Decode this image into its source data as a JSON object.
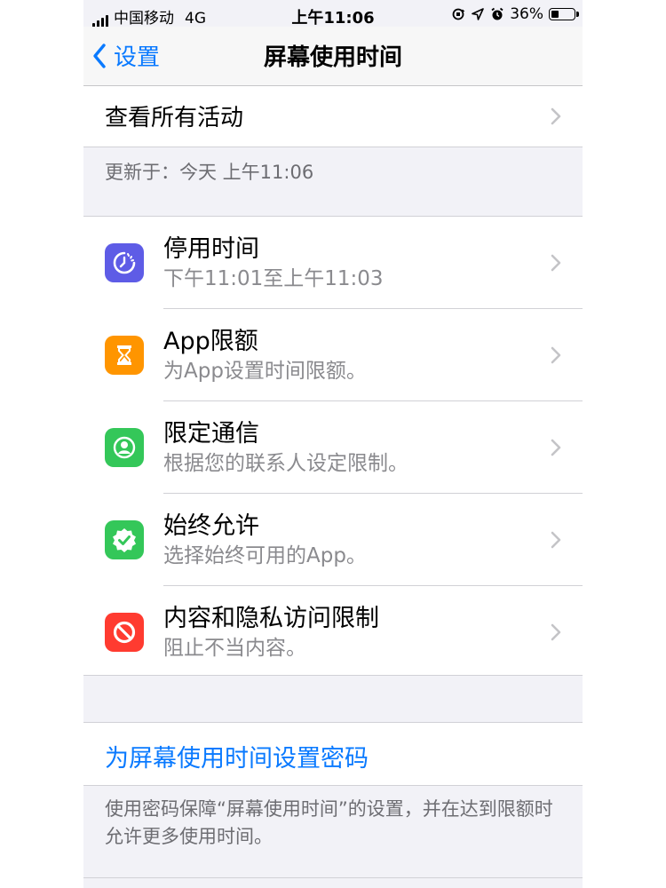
{
  "status_bar": {
    "carrier": "中国移动",
    "network": "4G",
    "time": "上午11:06",
    "battery_percent": "36%",
    "battery_level": 0.36
  },
  "nav": {
    "back_label": "设置",
    "title": "屏幕使用时间"
  },
  "activity": {
    "label": "查看所有活动",
    "updated": "更新于：今天 上午11:06"
  },
  "features": [
    {
      "title": "停用时间",
      "subtitle": "下午11:01至上午11:03",
      "icon": "downtime-icon",
      "color": "#5e5ce6"
    },
    {
      "title": "App限额",
      "subtitle": "为App设置时间限额。",
      "icon": "hourglass-icon",
      "color": "#ff9500"
    },
    {
      "title": "限定通信",
      "subtitle": "根据您的联系人设定限制。",
      "icon": "contact-icon",
      "color": "#34c759"
    },
    {
      "title": "始终允许",
      "subtitle": "选择始终可用的App。",
      "icon": "checkmark-seal-icon",
      "color": "#34c759"
    },
    {
      "title": "内容和隐私访问限制",
      "subtitle": "阻止不当内容。",
      "icon": "restriction-icon",
      "color": "#ff3b30"
    }
  ],
  "passcode": {
    "label": "为屏幕使用时间设置密码",
    "description": "使用密码保障“屏幕使用时间”的设置，并在达到限额时允许更多使用时间。"
  },
  "colors": {
    "accent": "#0a7aff",
    "background": "#f2f2f7"
  }
}
